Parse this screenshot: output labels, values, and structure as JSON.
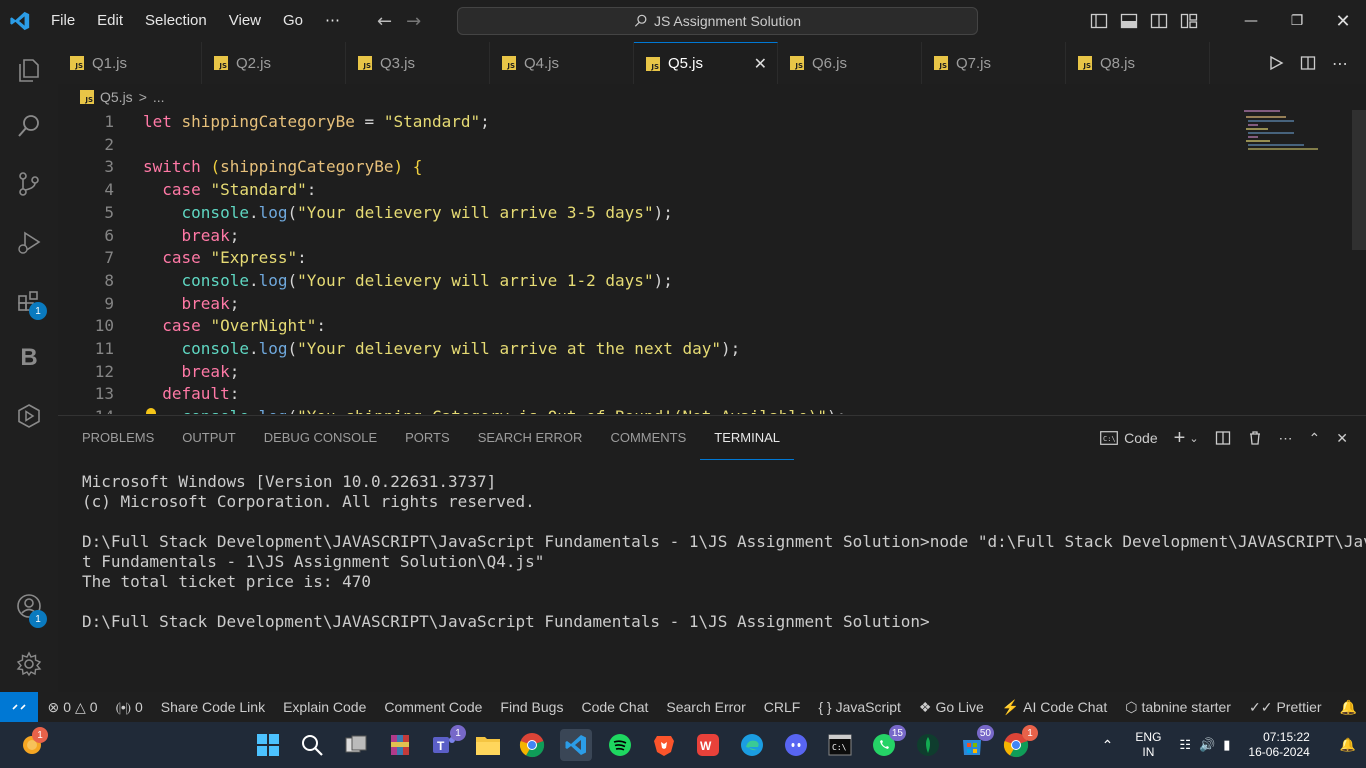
{
  "titlebar": {
    "menu": [
      "File",
      "Edit",
      "Selection",
      "View",
      "Go",
      "⋯"
    ],
    "search": "JS Assignment Solution"
  },
  "tabs": [
    {
      "label": "Q1.js",
      "active": false
    },
    {
      "label": "Q2.js",
      "active": false
    },
    {
      "label": "Q3.js",
      "active": false
    },
    {
      "label": "Q4.js",
      "active": false
    },
    {
      "label": "Q5.js",
      "active": true
    },
    {
      "label": "Q6.js",
      "active": false
    },
    {
      "label": "Q7.js",
      "active": false
    },
    {
      "label": "Q8.js",
      "active": false
    },
    {
      "label": "Q",
      "active": false
    }
  ],
  "breadcrumb": {
    "file": "Q5.js",
    "sep": ">",
    "rest": "..."
  },
  "editor": {
    "lines": [
      {
        "n": "1",
        "tokens": [
          [
            "kw2",
            "let "
          ],
          [
            "var",
            "shippingCategoryBe"
          ],
          [
            "punc",
            " = "
          ],
          [
            "str",
            "\"Standard\""
          ],
          [
            "punc",
            ";"
          ]
        ]
      },
      {
        "n": "2",
        "tokens": []
      },
      {
        "n": "3",
        "tokens": [
          [
            "kw2",
            "switch "
          ],
          [
            "brace",
            "("
          ],
          [
            "var",
            "shippingCategoryBe"
          ],
          [
            "brace",
            ")"
          ],
          [
            "punc",
            " "
          ],
          [
            "brace",
            "{"
          ]
        ]
      },
      {
        "n": "4",
        "tokens": [
          [
            "punc",
            "  "
          ],
          [
            "kw2",
            "case "
          ],
          [
            "str",
            "\"Standard\""
          ],
          [
            "punc",
            ":"
          ]
        ]
      },
      {
        "n": "5",
        "tokens": [
          [
            "punc",
            "    "
          ],
          [
            "obj",
            "console"
          ],
          [
            "punc",
            "."
          ],
          [
            "fn",
            "log"
          ],
          [
            "punc",
            "("
          ],
          [
            "str",
            "\"Your delievery will arrive 3-5 days\""
          ],
          [
            "punc",
            ");"
          ]
        ]
      },
      {
        "n": "6",
        "tokens": [
          [
            "punc",
            "    "
          ],
          [
            "kw2",
            "break"
          ],
          [
            "punc",
            ";"
          ]
        ]
      },
      {
        "n": "7",
        "tokens": [
          [
            "punc",
            "  "
          ],
          [
            "kw2",
            "case "
          ],
          [
            "str",
            "\"Express\""
          ],
          [
            "punc",
            ":"
          ]
        ]
      },
      {
        "n": "8",
        "tokens": [
          [
            "punc",
            "    "
          ],
          [
            "obj",
            "console"
          ],
          [
            "punc",
            "."
          ],
          [
            "fn",
            "log"
          ],
          [
            "punc",
            "("
          ],
          [
            "str",
            "\"Your delievery will arrive 1-2 days\""
          ],
          [
            "punc",
            ");"
          ]
        ]
      },
      {
        "n": "9",
        "tokens": [
          [
            "punc",
            "    "
          ],
          [
            "kw2",
            "break"
          ],
          [
            "punc",
            ";"
          ]
        ]
      },
      {
        "n": "10",
        "tokens": [
          [
            "punc",
            "  "
          ],
          [
            "kw2",
            "case "
          ],
          [
            "str",
            "\"OverNight\""
          ],
          [
            "punc",
            ":"
          ]
        ]
      },
      {
        "n": "11",
        "tokens": [
          [
            "punc",
            "    "
          ],
          [
            "obj",
            "console"
          ],
          [
            "punc",
            "."
          ],
          [
            "fn",
            "log"
          ],
          [
            "punc",
            "("
          ],
          [
            "str",
            "\"Your delievery will arrive at the next day\""
          ],
          [
            "punc",
            ");"
          ]
        ]
      },
      {
        "n": "12",
        "tokens": [
          [
            "punc",
            "    "
          ],
          [
            "kw2",
            "break"
          ],
          [
            "punc",
            ";"
          ]
        ]
      },
      {
        "n": "13",
        "tokens": [
          [
            "punc",
            "  "
          ],
          [
            "kw2",
            "default"
          ],
          [
            "punc",
            ":"
          ]
        ]
      },
      {
        "n": "14",
        "tokens": [
          [
            "punc",
            "    "
          ],
          [
            "obj",
            "console"
          ],
          [
            "punc",
            "."
          ],
          [
            "fn",
            "log"
          ],
          [
            "punc",
            "("
          ],
          [
            "str",
            "\"You shipping Category is Out of Bound!(Not Available)\""
          ],
          [
            "punc",
            ");"
          ]
        ]
      }
    ]
  },
  "panel": {
    "tabs": [
      "PROBLEMS",
      "OUTPUT",
      "DEBUG CONSOLE",
      "PORTS",
      "SEARCH ERROR",
      "COMMENTS",
      "TERMINAL"
    ],
    "active_tab": "TERMINAL",
    "terminal_name": "Code",
    "terminal_lines": [
      "Microsoft Windows [Version 10.0.22631.3737]",
      "(c) Microsoft Corporation. All rights reserved.",
      "",
      "D:\\Full Stack Development\\JAVASCRIPT\\JavaScript Fundamentals - 1\\JS Assignment Solution>node \"d:\\Full Stack Development\\JAVASCRIPT\\JavaScrip",
      "t Fundamentals - 1\\JS Assignment Solution\\Q4.js\"",
      "The total ticket price is: 470",
      "",
      "D:\\Full Stack Development\\JAVASCRIPT\\JavaScript Fundamentals - 1\\JS Assignment Solution>"
    ]
  },
  "statusbar": {
    "errors": "0",
    "warnings": "0",
    "ports": "0",
    "items": [
      "Share Code Link",
      "Explain Code",
      "Comment Code",
      "Find Bugs",
      "Code Chat",
      "Search Error",
      "CRLF"
    ],
    "language": "JavaScript",
    "golive": "Go Live",
    "ai_chat": "AI Code Chat",
    "tabnine": "tabnine starter",
    "prettier": "Prettier"
  },
  "activity": {
    "extensions_badge": "1",
    "accounts_badge": "1"
  },
  "taskbar": {
    "weather_badge": "1",
    "teams_badge": "1",
    "whatsapp_badge": "15",
    "store_badge": "50",
    "chrome2_badge": "1",
    "lang_top": "ENG",
    "lang_bottom": "IN",
    "time": "07:15:22",
    "date": "16-06-2024"
  },
  "colors": {
    "accent": "#0078d4",
    "js_badge": "#e8c547",
    "statusbar": "#1f1f1f"
  }
}
